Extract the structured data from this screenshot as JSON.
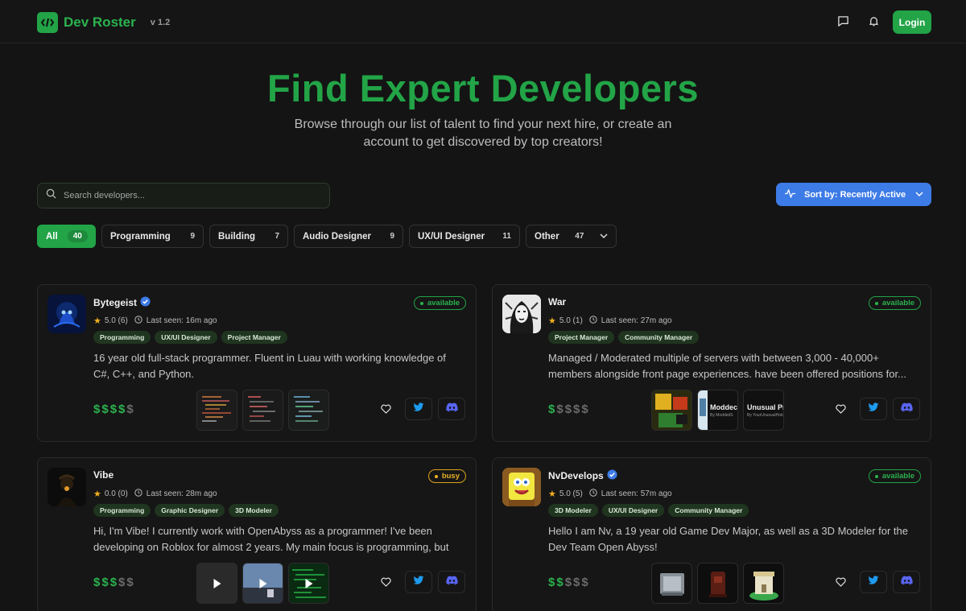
{
  "header": {
    "logo": "Dev Roster",
    "version": "v 1.2",
    "login_label": "Login"
  },
  "hero": {
    "title": "Find Expert Developers",
    "subtitle": "Browse through our list of talent to find your next hire, or create an account to get discovered by top creators!"
  },
  "search": {
    "placeholder": "Search developers..."
  },
  "sort": {
    "label": "Sort by: Recently Active"
  },
  "filters": [
    {
      "label": "All",
      "count": "40"
    },
    {
      "label": "Programming",
      "count": "9"
    },
    {
      "label": "Building",
      "count": "7"
    },
    {
      "label": "Audio Designer",
      "count": "9"
    },
    {
      "label": "UX/UI Designer",
      "count": "11"
    },
    {
      "label": "Other",
      "count": "47"
    }
  ],
  "cards": [
    {
      "name": "Bytegeist",
      "verified": true,
      "rating": "5.0 (6)",
      "last_seen": "Last seen: 16m ago",
      "status": "available",
      "tags": [
        "Programming",
        "UX/UI Designer",
        "Project Manager"
      ],
      "description": "16 year old full-stack programmer. Fluent in Luau with working knowledge of C#, C++, and Python.",
      "price_level": 4
    },
    {
      "name": "War",
      "verified": false,
      "rating": "5.0 (1)",
      "last_seen": "Last seen: 27m ago",
      "status": "available",
      "tags": [
        "Project Manager",
        "Community Manager"
      ],
      "description": "Managed / Moderated multiple of servers with between 3,000 - 40,000+ members alongside front page experiences. have been offered positions for...",
      "price_level": 1,
      "thumb_texts": [
        "Moddec",
        "By ModdedS",
        "Unusual Pro",
        "By YourUnusualHold"
      ]
    },
    {
      "name": "Vibe",
      "verified": false,
      "rating": "0.0 (0)",
      "last_seen": "Last seen: 28m ago",
      "status": "busy",
      "tags": [
        "Programming",
        "Graphic Designer",
        "3D Modeler"
      ],
      "description": "Hi, I'm Vibe! I currently work with OpenAbyss as a programmer! I've been developing on Roblox for almost 2 years. My main focus is programming, but I...",
      "price_level": 3
    },
    {
      "name": "NvDevelops",
      "verified": true,
      "rating": "5.0 (5)",
      "last_seen": "Last seen: 57m ago",
      "status": "available",
      "tags": [
        "3D Modeler",
        "UX/UI Designer",
        "Community Manager"
      ],
      "description": "Hello I am Nv, a 19 year old Game Dev Major, as well as a 3D Modeler for the Dev Team Open Abyss!",
      "price_level": 2
    }
  ],
  "colors": {
    "brand_green": "#22a447",
    "sort_blue": "#3d7be6",
    "busy_amber": "#e8b024",
    "twitter_blue": "#1d9bf0",
    "discord_blurple": "#5865f2"
  }
}
